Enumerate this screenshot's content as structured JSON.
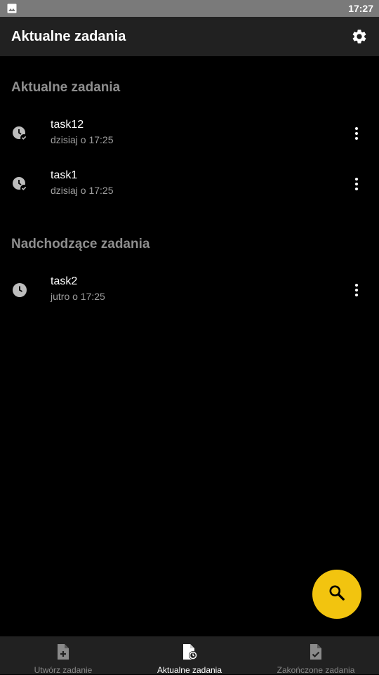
{
  "status_bar": {
    "time": "17:27",
    "left_icon": "image-icon"
  },
  "app_bar": {
    "title": "Aktualne zadania",
    "settings_icon": "gear-icon"
  },
  "sections": [
    {
      "header": "Aktualne zadania",
      "items": [
        {
          "title": "task12",
          "subtitle": "dzisiaj o 17:25",
          "icon": "clock-check-icon"
        },
        {
          "title": "task1",
          "subtitle": "dzisiaj o 17:25",
          "icon": "clock-check-icon"
        }
      ]
    },
    {
      "header": "Nadchodzące zadania",
      "items": [
        {
          "title": "task2",
          "subtitle": "jutro o 17:25",
          "icon": "clock-icon"
        }
      ]
    }
  ],
  "fab": {
    "icon": "search-icon",
    "color": "#f2c40f"
  },
  "bottom_nav": [
    {
      "label": "Utwórz zadanie",
      "icon": "file-plus-icon",
      "active": false
    },
    {
      "label": "Aktualne zadania",
      "icon": "file-clock-icon",
      "active": true
    },
    {
      "label": "Zakończone zadania",
      "icon": "file-check-icon",
      "active": false
    }
  ]
}
